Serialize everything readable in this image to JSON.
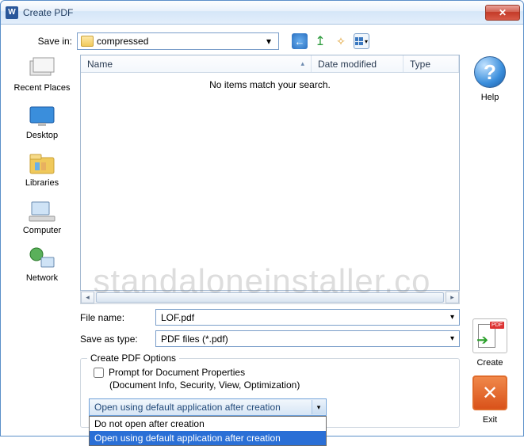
{
  "window": {
    "title": "Create PDF"
  },
  "topbar": {
    "save_in_label": "Save in:",
    "save_in_value": "compressed"
  },
  "list": {
    "col_name": "Name",
    "col_date": "Date modified",
    "col_type": "Type",
    "empty": "No items match your search."
  },
  "places": [
    {
      "label": "Recent Places"
    },
    {
      "label": "Desktop"
    },
    {
      "label": "Libraries"
    },
    {
      "label": "Computer"
    },
    {
      "label": "Network"
    }
  ],
  "form": {
    "filename_label": "File name:",
    "filename_value": "LOF.pdf",
    "saveastype_label": "Save as type:",
    "saveastype_value": "PDF files (*.pdf)"
  },
  "options": {
    "legend": "Create PDF Options",
    "prompt_label": "Prompt for Document Properties",
    "prompt_helper": "(Document Info, Security, View, Optimization)"
  },
  "combo": {
    "selected": "Open using default application after creation",
    "opt1": "Do not open after creation",
    "opt2": "Open using default application after creation"
  },
  "rightcol": {
    "help": "Help",
    "create": "Create",
    "exit": "Exit"
  },
  "watermark": "standaloneinstaller.co"
}
